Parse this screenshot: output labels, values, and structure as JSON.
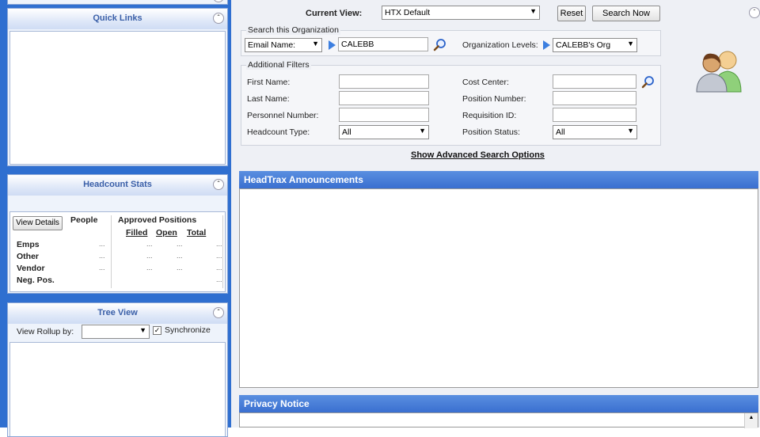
{
  "sidebar": {
    "quick_links": {
      "title": "Quick Links"
    },
    "headcount_stats": {
      "title": "Headcount Stats",
      "view_details_label": "View Details",
      "people_header": "People",
      "approved_positions_header": "Approved Positions",
      "filled_header": "Filled",
      "open_header": "Open",
      "total_header": "Total",
      "rows": [
        {
          "label": "Emps",
          "people": "...",
          "filled": "...",
          "open": "...",
          "total": "..."
        },
        {
          "label": "Other",
          "people": "...",
          "filled": "...",
          "open": "...",
          "total": "..."
        },
        {
          "label": "Vendor",
          "people": "...",
          "filled": "...",
          "open": "...",
          "total": "..."
        },
        {
          "label": "Neg. Pos.",
          "people": "",
          "filled": "",
          "open": "",
          "total": "..."
        }
      ]
    },
    "tree_view": {
      "title": "Tree View",
      "rollup_label": "View Rollup by:",
      "rollup_value": "",
      "synchronize_label": "Synchronize",
      "synchronize_checked": true
    }
  },
  "toolbar": {
    "current_view_label": "Current View:",
    "current_view_value": "HTX Default",
    "reset_label": "Reset",
    "search_now_label": "Search Now"
  },
  "search_org": {
    "legend": "Search this Organization",
    "field_select_value": "Email Name:",
    "field_value": "CALEBB",
    "org_levels_label": "Organization Levels:",
    "org_levels_value": "CALEBB's Org"
  },
  "filters": {
    "legend": "Additional Filters",
    "first_name_label": "First Name:",
    "last_name_label": "Last Name:",
    "personnel_number_label": "Personnel Number:",
    "headcount_type_label": "Headcount Type:",
    "headcount_type_value": "All",
    "cost_center_label": "Cost Center:",
    "position_number_label": "Position Number:",
    "requisition_id_label": "Requisition ID:",
    "position_status_label": "Position Status:",
    "position_status_value": "All"
  },
  "advanced_search_label": "Show Advanced Search Options",
  "announcements": {
    "title": "HeadTrax Announcements"
  },
  "privacy": {
    "title": "Privacy Notice"
  },
  "colors": {
    "sidebar_bg": "#2f6fd0",
    "section_header": "#3a6fd0"
  }
}
